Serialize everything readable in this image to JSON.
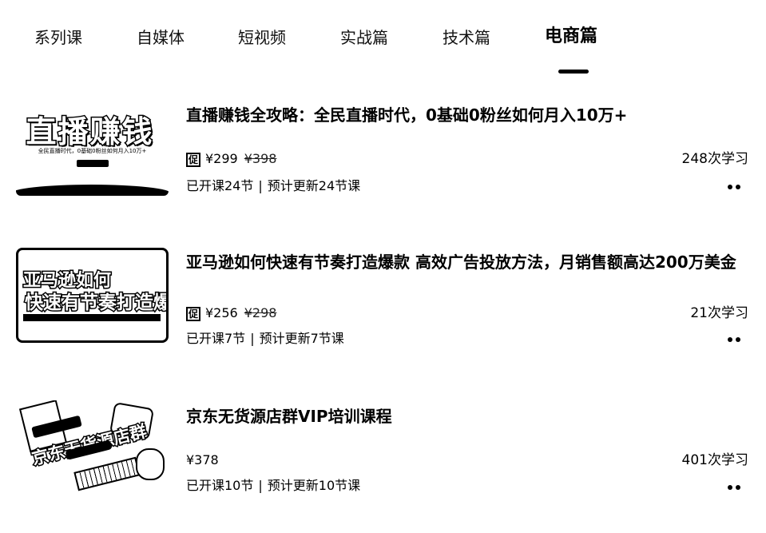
{
  "tabs": [
    {
      "label": "系列课",
      "active": false
    },
    {
      "label": "自媒体",
      "active": false
    },
    {
      "label": "短视频",
      "active": false
    },
    {
      "label": "实战篇",
      "active": false
    },
    {
      "label": "技术篇",
      "active": false
    },
    {
      "label": "电商篇",
      "active": true
    }
  ],
  "courses": [
    {
      "title": "直播赚钱全攻略：全民直播时代，0基础0粉丝如何月入10万+",
      "promo_badge": "促",
      "price": "¥299",
      "original_price": "¥398",
      "learners": "248次学习",
      "opened": "已开课24节",
      "separator": "|",
      "planned": "预计更新24节课",
      "thumb": {
        "headline": "直播赚钱",
        "subtitle": "全民直播时代，0基础0粉丝如何月入10万+"
      }
    },
    {
      "title": "亚马逊如何快速有节奏打造爆款 高效广告投放方法，月销售额高达200万美金",
      "promo_badge": "促",
      "price": "¥256",
      "original_price": "¥298",
      "learners": "21次学习",
      "opened": "已开课7节",
      "separator": "|",
      "planned": "预计更新7节课",
      "thumb": {
        "line1": "亚马逊如何",
        "line2": "快速有节奏打造爆款"
      }
    },
    {
      "title": "京东无货源店群VIP培训课程",
      "price": "¥378",
      "learners": "401次学习",
      "opened": "已开课10节",
      "separator": "|",
      "planned": "预计更新10节课",
      "thumb": {
        "headline": "京东无货源店群"
      }
    }
  ],
  "icons": {
    "more": "more-dots-icon",
    "promo": "promo-badge-icon"
  },
  "colors": {
    "text": "#000000",
    "background": "#ffffff"
  }
}
